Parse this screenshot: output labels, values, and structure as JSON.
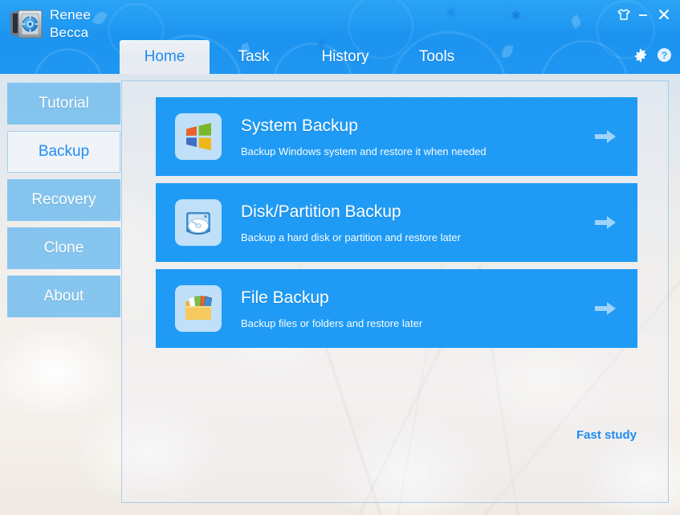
{
  "window": {
    "brand_line1": "Renee",
    "brand_line2": "Becca",
    "app_icon": "safe-vault-icon",
    "controls": {
      "skin": "skin-icon",
      "minimize": "minimize-icon",
      "close": "close-icon"
    }
  },
  "tabs": [
    {
      "id": "home",
      "label": "Home",
      "active": true
    },
    {
      "id": "task",
      "label": "Task",
      "active": false
    },
    {
      "id": "history",
      "label": "History",
      "active": false
    },
    {
      "id": "tools",
      "label": "Tools",
      "active": false
    }
  ],
  "header_tools": [
    {
      "id": "settings",
      "icon": "gear-icon"
    },
    {
      "id": "help",
      "icon": "help-circle-icon"
    }
  ],
  "sidebar": {
    "items": [
      {
        "id": "tutorial",
        "label": "Tutorial",
        "active": false
      },
      {
        "id": "backup",
        "label": "Backup",
        "active": true
      },
      {
        "id": "recovery",
        "label": "Recovery",
        "active": false
      },
      {
        "id": "clone",
        "label": "Clone",
        "active": false
      },
      {
        "id": "about",
        "label": "About",
        "active": false
      }
    ]
  },
  "main": {
    "cards": [
      {
        "id": "system-backup",
        "title": "System Backup",
        "desc": "Backup Windows system and restore it when needed",
        "icon": "windows-flag-icon",
        "arrow": "arrow-right-icon"
      },
      {
        "id": "disk-partition-backup",
        "title": "Disk/Partition Backup",
        "desc": "Backup a hard disk or partition and restore later",
        "icon": "hard-disk-icon",
        "arrow": "arrow-right-icon"
      },
      {
        "id": "file-backup",
        "title": "File Backup",
        "desc": "Backup files or folders and restore later",
        "icon": "folder-files-icon",
        "arrow": "arrow-right-icon"
      }
    ],
    "fast_study_label": "Fast study"
  },
  "colors": {
    "header_blue": "#1f97f2",
    "card_blue": "#1f9bf5",
    "accent_link": "#1f8cf0",
    "sidebar_blue": "#76beee"
  }
}
